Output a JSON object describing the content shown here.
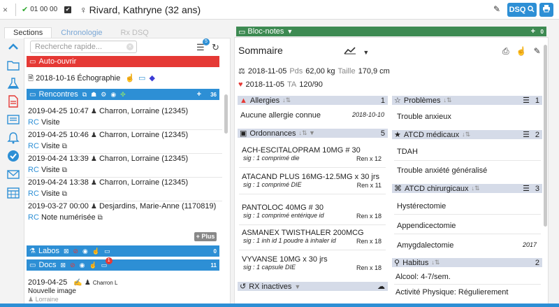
{
  "topbar": {
    "check_number": "01 00 00",
    "patient_name": "Rivard, Kathryne (32 ans)",
    "dsq_label": "DSQ"
  },
  "tabs": [
    "Sections",
    "Chronologie",
    "Rx DSQ"
  ],
  "search_placeholder": "Recherche rapide...",
  "list_badge": "5",
  "auto_ouvrir": "Auto-ouvrir",
  "echographie": "2018-10-16 Échographie",
  "rencontres": {
    "label": "Rencontres",
    "count": "36"
  },
  "encounters": [
    {
      "date": "2019-04-25 10:47",
      "who": "Charron, Lorraine (12345)",
      "rc": "RC",
      "type": "Visite"
    },
    {
      "date": "2019-04-25 10:46",
      "who": "Charron, Lorraine (12345)",
      "rc": "RC",
      "type": "Visite"
    },
    {
      "date": "2019-04-24 13:39",
      "who": "Charron, Lorraine (12345)",
      "rc": "RC",
      "type": "Visite"
    },
    {
      "date": "2019-04-24 13:38",
      "who": "Charron, Lorraine (12345)",
      "rc": "RC",
      "type": "Visite"
    },
    {
      "date": "2019-03-27 00:00",
      "who": "Desjardins, Marie-Anne (1170819)",
      "rc": "RC",
      "type": "Note numérisée"
    }
  ],
  "plus_label": "+ Plus",
  "labos": {
    "label": "Labos",
    "count": "0"
  },
  "docs": {
    "label": "Docs",
    "count": "11",
    "badge": "1"
  },
  "doc_item": {
    "date": "2019-04-25",
    "who": "Charron L",
    "title": "Nouvelle image",
    "sub": "Lorraine"
  },
  "bloc_notes": {
    "label": "Bloc-notes",
    "count": "0"
  },
  "sommaire": "Sommaire",
  "vitals": [
    {
      "date": "2018-11-05",
      "l1": "Pds",
      "v1": "62,00 kg",
      "l2": "Taille",
      "v2": "170,9 cm"
    },
    {
      "date": "2018-11-05",
      "l1": "TA",
      "v1": "120/90",
      "l2": "",
      "v2": ""
    }
  ],
  "allergies": {
    "label": "Allergies",
    "count": "1",
    "items": [
      {
        "text": "Aucune allergie connue",
        "date": "2018-10-10"
      }
    ]
  },
  "ordonnances": {
    "label": "Ordonnances",
    "count": "5",
    "items": [
      {
        "name": "ACH-ESCITALOPRAM 10MG # 30",
        "sig": "sig : 1 comprimé die",
        "ren": "Ren x 12"
      },
      {
        "name": "ATACAND PLUS 16MG-12.5MG x 30 jrs",
        "sig": "sig : 1 comprimé DIE",
        "ren": "Ren x 11"
      },
      {
        "name": "PANTOLOC 40MG # 30",
        "sig": "sig : 1 comprimé entérique id",
        "ren": "Ren x 18"
      },
      {
        "name": "ASMANEX TWISTHALER 200MCG",
        "sig": "sig : 1 inh id 1 poudre à inhaler id",
        "ren": "Ren x 18"
      },
      {
        "name": "VYVANSE 10MG x 30 jrs",
        "sig": "sig : 1 capsule DIE",
        "ren": "Ren x 18"
      }
    ]
  },
  "rx_inactives": "RX inactives",
  "problemes": {
    "label": "Problèmes",
    "count": "1",
    "items": [
      "Trouble anxieux"
    ]
  },
  "atcd_medicaux": {
    "label": "ATCD médicaux",
    "count": "2",
    "items": [
      "TDAH",
      "Trouble anxiété généralisé"
    ]
  },
  "atcd_chirurgicaux": {
    "label": "ATCD chirurgicaux",
    "count": "3",
    "items": [
      {
        "text": "Hystérectomie",
        "date": ""
      },
      {
        "text": "Appendicectomie",
        "date": ""
      },
      {
        "text": "Amygdalectomie",
        "date": "2017"
      }
    ]
  },
  "habitus": {
    "label": "Habitus",
    "count": "2",
    "items": [
      "Alcool: 4-7/sem.",
      "Activité Physique: Régulierement"
    ]
  }
}
